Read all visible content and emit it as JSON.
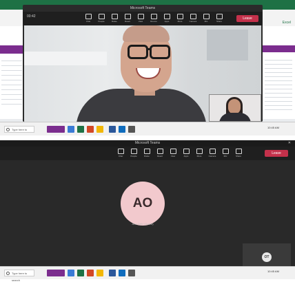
{
  "top": {
    "window_title": "Microsoft Teams",
    "call_timer": "00:42",
    "toolbar": [
      {
        "label": "Chat"
      },
      {
        "label": "People"
      },
      {
        "label": "Raise"
      },
      {
        "label": "React"
      },
      {
        "label": "View"
      },
      {
        "label": "Rooms"
      },
      {
        "label": "Apps"
      },
      {
        "label": "More"
      },
      {
        "label": "Camera"
      },
      {
        "label": "Mic"
      },
      {
        "label": "Share"
      }
    ],
    "leave_label": "Leave",
    "excel_label": "Excel"
  },
  "bottom": {
    "window_title": "Microsoft Teams",
    "close_label": "✕",
    "toolbar": [
      {
        "label": "Chat"
      },
      {
        "label": "People"
      },
      {
        "label": "Raise"
      },
      {
        "label": "React"
      },
      {
        "label": "View"
      },
      {
        "label": "Apps"
      },
      {
        "label": "More"
      },
      {
        "label": "Camera"
      },
      {
        "label": "Mic"
      },
      {
        "label": "Share"
      }
    ],
    "leave_label": "Leave",
    "participant_initials": "AO",
    "participant_name": "Ana Ortiz (Guest)",
    "self_initials": "OT"
  },
  "taskbar": {
    "search_placeholder": "Type here to search",
    "time": "10:45 AM"
  },
  "colors": {
    "teams_dark": "#292929",
    "leave_red": "#c4314b",
    "excel_green": "#1e7145",
    "accent_purple": "#7b2d8e",
    "avatar_pink": "#f2c9cd"
  }
}
